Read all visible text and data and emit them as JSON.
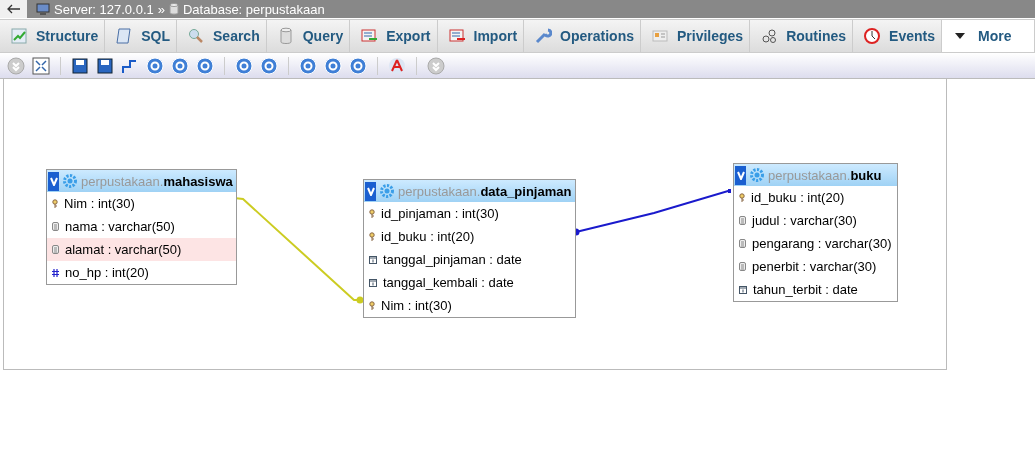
{
  "breadcrumb": {
    "server": "Server: 127.0.0.1",
    "separator": "»",
    "database": "Database: perpustakaan"
  },
  "tabs": [
    {
      "label": "Structure",
      "selected": false
    },
    {
      "label": "SQL",
      "selected": false
    },
    {
      "label": "Search",
      "selected": false
    },
    {
      "label": "Query",
      "selected": false
    },
    {
      "label": "Export",
      "selected": false
    },
    {
      "label": "Import",
      "selected": false
    },
    {
      "label": "Operations",
      "selected": false
    },
    {
      "label": "Privileges",
      "selected": false
    },
    {
      "label": "Routines",
      "selected": false
    },
    {
      "label": "Events",
      "selected": false
    },
    {
      "label": "More",
      "selected": true
    }
  ],
  "relations": [
    {
      "color": "#cccc22"
    },
    {
      "color": "#1a1acc"
    }
  ],
  "tables": [
    {
      "schema": "perpustakaan.",
      "name": "mahasiswa",
      "columns": [
        {
          "kind": "key",
          "text": "Nim : int(30)",
          "highlighted": false
        },
        {
          "kind": "text",
          "text": "nama : varchar(50)",
          "highlighted": false
        },
        {
          "kind": "text",
          "text": "alamat : varchar(50)",
          "highlighted": true
        },
        {
          "kind": "number",
          "text": "no_hp : int(20)",
          "highlighted": false
        }
      ]
    },
    {
      "schema": "perpustakaan.",
      "name": "data_pinjaman",
      "columns": [
        {
          "kind": "key",
          "text": "id_pinjaman : int(30)",
          "highlighted": false
        },
        {
          "kind": "key",
          "text": "id_buku : int(20)",
          "highlighted": false
        },
        {
          "kind": "date",
          "text": "tanggal_pinjaman : date",
          "highlighted": false
        },
        {
          "kind": "date",
          "text": "tanggal_kembali : date",
          "highlighted": false
        },
        {
          "kind": "key",
          "text": "Nim : int(30)",
          "highlighted": false
        }
      ]
    },
    {
      "schema": "perpustakaan.",
      "name": "buku",
      "columns": [
        {
          "kind": "key",
          "text": "id_buku : int(20)",
          "highlighted": false
        },
        {
          "kind": "text",
          "text": "judul : varchar(30)",
          "highlighted": false
        },
        {
          "kind": "text",
          "text": "pengarang : varchar(30)",
          "highlighted": false
        },
        {
          "kind": "text",
          "text": "penerbit : varchar(30)",
          "highlighted": false
        },
        {
          "kind": "date",
          "text": "tahun_terbit : date",
          "highlighted": false
        }
      ]
    }
  ]
}
